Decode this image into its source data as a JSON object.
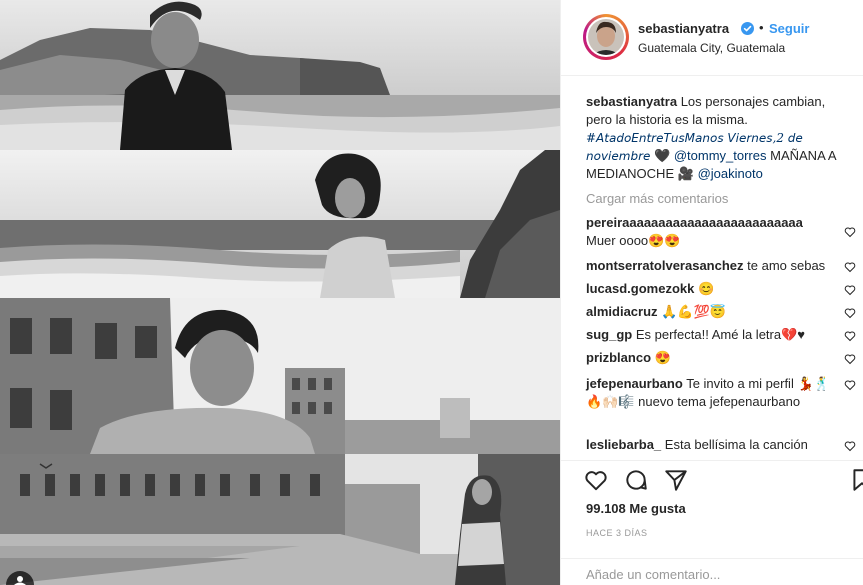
{
  "header": {
    "username": "sebastianyatra",
    "separator": "•",
    "follow_label": "Seguir",
    "location": "Guatemala City, Guatemala"
  },
  "caption": {
    "username": "sebastianyatra",
    "text1": "Los personajes cambian, pero la historia es la misma.",
    "hashtag": "#𝘈𝘵𝘢𝘥𝘰𝘌𝘯𝘵𝘳𝘦𝘛𝘶𝘴𝘔𝘢𝘯𝘰𝘴 𝘝𝘪𝘦𝘳𝘯𝘦𝘴,2 𝘥𝘦 𝘯𝘰𝘷𝘪𝘦𝘮𝘣𝘳𝘦",
    "heart": "🖤",
    "mention1": "@tommy_torres",
    "text2": "MAÑANA A MEDIANOCHE",
    "camera": "🎥",
    "mention2": "@joakinoto"
  },
  "load_more_label": "Cargar más comentarios",
  "comments": [
    {
      "user": "pereiraaaaaaaaaaaaaaaaaaaaaaaaa",
      "text": "Muer oooo😍😍"
    },
    {
      "user": "montserratolverasanchez",
      "text": "te amo sebas"
    },
    {
      "user": "lucasd.gomezokk",
      "text": "😊"
    },
    {
      "user": "almidiacruz",
      "text": "🙏💪💯😇"
    },
    {
      "user": "sug_gp",
      "text": "Es perfecta!! Amé la letra💔♥"
    },
    {
      "user": "prizblanco",
      "text": "😍"
    },
    {
      "user": "jefepenaurbano",
      "text": "Te invito a mi perfil 💃🕺🔥🙌🏻🎼 nuevo tema jefepenaurbano"
    },
    {
      "user": "lesliebarba_",
      "text": "Esta bellísima la canción"
    }
  ],
  "actions": {
    "likes": "99.108 Me gusta",
    "time": "HACE 3 DÍAS",
    "add_comment_placeholder": "Añade un comentario..."
  },
  "colors": {
    "link_blue": "#3897f0",
    "mention_blue": "#003569",
    "muted": "#999999",
    "text": "#262626",
    "border": "#efefef"
  },
  "icons": [
    "verified-icon",
    "heart-outline-icon",
    "comment-icon",
    "share-icon",
    "bookmark-icon"
  ]
}
